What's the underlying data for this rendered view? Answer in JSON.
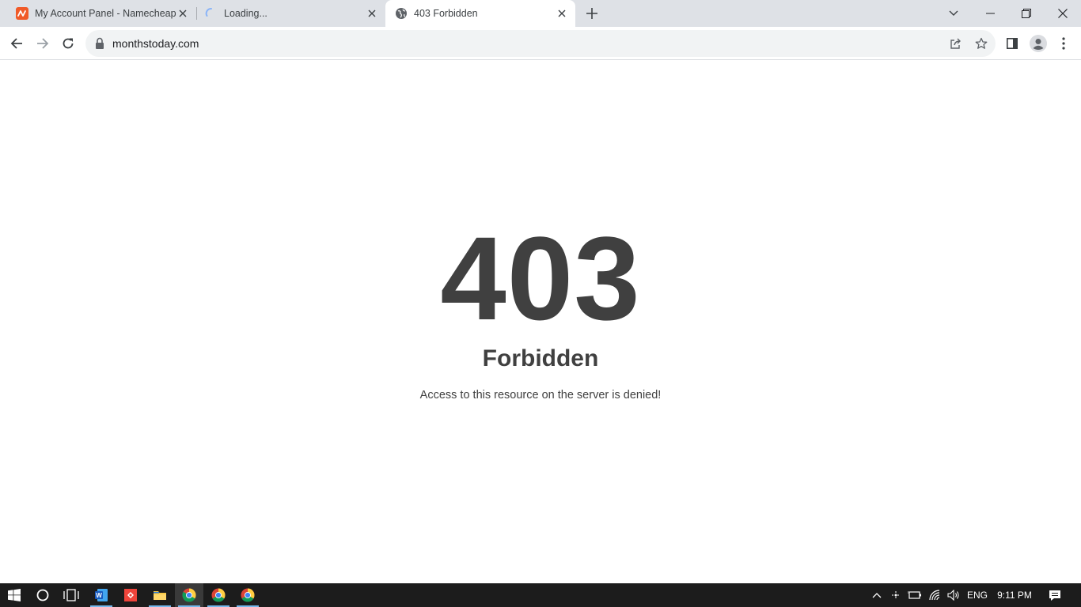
{
  "browser": {
    "tabs": [
      {
        "title": "My Account Panel - Namecheap",
        "favicon": "namecheap-logo-icon",
        "state": "inactive"
      },
      {
        "title": "Loading...",
        "favicon": "loading-spinner-icon",
        "state": "inactive"
      },
      {
        "title": "403 Forbidden",
        "favicon": "globe-icon",
        "state": "active"
      }
    ],
    "address": "monthstoday.com"
  },
  "page": {
    "code": "403",
    "title": "Forbidden",
    "message": "Access to this resource on the server is denied!"
  },
  "taskbar": {
    "apps": [
      "start-icon",
      "cortana-icon",
      "task-view-icon",
      "word-icon",
      "anydesk-icon",
      "file-explorer-icon",
      "chrome-icon",
      "chrome-icon",
      "chrome-icon"
    ],
    "language": "ENG",
    "time": "9:11 PM"
  },
  "colors": {
    "tabstrip": "#dee1e6",
    "text_dark": "#404040",
    "taskbar": "#1c1c1c",
    "namecheap": "#f05a28"
  }
}
